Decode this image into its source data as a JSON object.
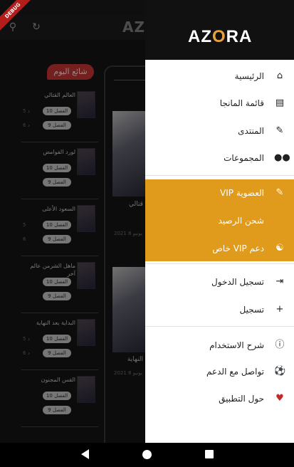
{
  "debug_banner": "DEBUG",
  "background": {
    "logo": "AZORA",
    "trending_label": "شائع اليوم",
    "rows": [
      {
        "title": "العالم القتالي",
        "ch1": "الفصل 10",
        "ch2": "الفصل 9",
        "t1": "5 د",
        "t2": "6 د"
      },
      {
        "title": "لورد الفوامض",
        "ch1": "الفصل 10",
        "ch2": "الفصل 9",
        "t1": "",
        "t2": ""
      },
      {
        "title": "السعود الأعلى",
        "ch1": "الفصل 10",
        "ch2": "الفصل 9",
        "t1": "5",
        "t2": "6"
      },
      {
        "title": "ماهل الشرمن عالم آخر",
        "ch1": "الفصل 10",
        "ch2": "الفصل 9",
        "t1": "",
        "t2": ""
      },
      {
        "title": "البداية بعد النهاية",
        "ch1": "الفصل 10",
        "ch2": "الفصل 9",
        "t1": "5 د",
        "t2": "6 د"
      },
      {
        "title": "القس المجنون",
        "ch1": "الفصل 10",
        "ch2": "الفصل 9",
        "t1": "",
        "t2": ""
      }
    ],
    "panel_item_1": "قتالي",
    "panel_date_1": "2021 8 يونيو",
    "panel_item_2": "النهاية",
    "panel_date_2": "2021 8 يونيو"
  },
  "drawer": {
    "brand": "AZORA",
    "items": [
      {
        "label": "الرئيسية",
        "icon": "home-icon"
      },
      {
        "label": "قائمة المانجا",
        "icon": "library-icon"
      },
      {
        "label": "المنتدى",
        "icon": "forum-icon"
      },
      {
        "label": "المجموعات",
        "icon": "groups-icon"
      },
      {
        "label": "العضوية VIP",
        "icon": "edit-icon"
      },
      {
        "label": "شحن الرصيد",
        "icon": ""
      },
      {
        "label": "دعم VIP خاص",
        "icon": "support-icon"
      },
      {
        "label": "تسجيل الدخول",
        "icon": "login-icon"
      },
      {
        "label": "تسجيل",
        "icon": "person-add-icon"
      },
      {
        "label": "شرح الاستخدام",
        "icon": "info-icon"
      },
      {
        "label": "تواصل مع الدعم",
        "icon": "support-ball-icon"
      },
      {
        "label": "حول التطبيق",
        "icon": "heart-icon"
      }
    ]
  },
  "colors": {
    "vip_accent": "#e09a1c",
    "trending": "#d83a3a",
    "heart": "#c62828"
  }
}
